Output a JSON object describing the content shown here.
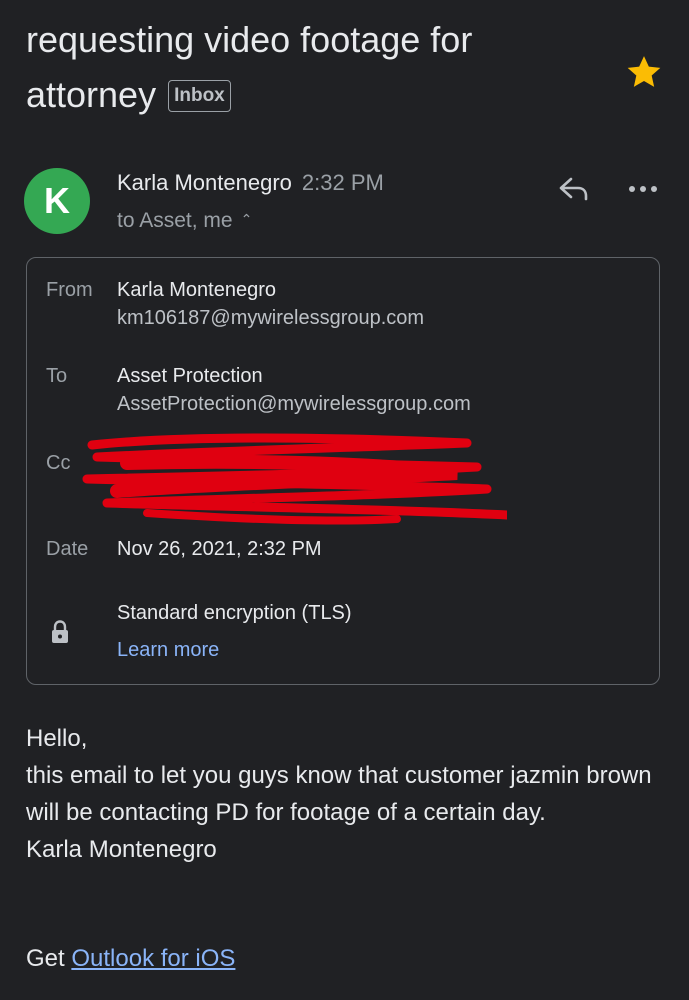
{
  "email": {
    "subject": "requesting video footage for attorney",
    "label": "Inbox",
    "starred": true
  },
  "sender": {
    "avatar_letter": "K",
    "avatar_color": "#34a853",
    "name": "Karla Montenegro",
    "time": "2:32 PM",
    "to_summary": "to Asset, me"
  },
  "details": {
    "from_label": "From",
    "from_name": "Karla Montenegro",
    "from_email": "km106187@mywirelessgroup.com",
    "to_label": "To",
    "to_name": "Asset Protection",
    "to_email": "AssetProtection@mywirelessgroup.com",
    "cc_label": "Cc",
    "date_label": "Date",
    "date_value": "Nov 26, 2021, 2:32 PM",
    "encryption": "Standard encryption (TLS)",
    "learn_more": "Learn more"
  },
  "message": {
    "lines": [
      "Hello,",
      "this email to let you guys know that customer jazmin brown will be contacting PD for footage of a certain day.",
      "Karla Montenegro"
    ],
    "signature_prefix": "Get",
    "signature_link": "Outlook for iOS"
  },
  "colors": {
    "background": "#202124",
    "star": "#fbbc04",
    "link": "#8ab4f8",
    "redaction": "#e00010"
  }
}
